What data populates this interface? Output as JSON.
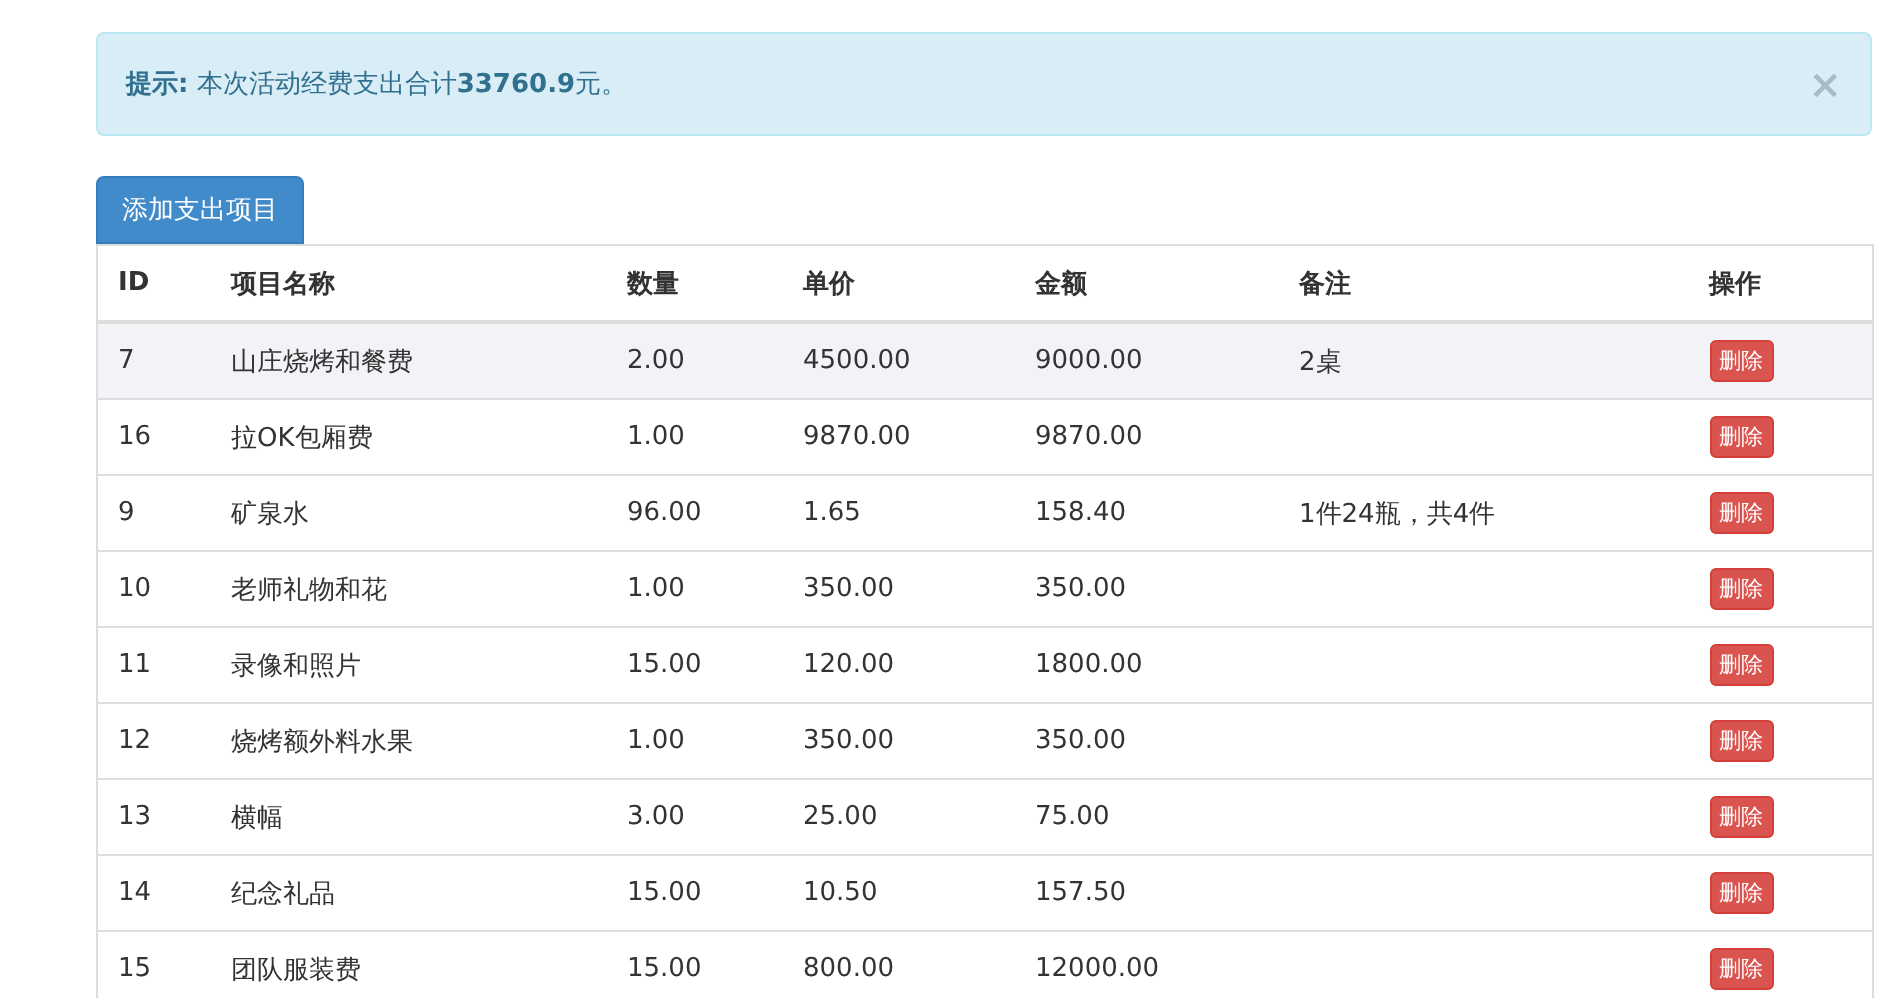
{
  "alert": {
    "message": "**提示:** 本次活动经费支出合计**33760.9**元。",
    "close": "×"
  },
  "add_button": "添加支出项目",
  "table": {
    "columns": [
      "ID",
      "项目名称",
      "数量",
      "单价",
      "金额",
      "备注",
      "操作"
    ],
    "rows": [
      {
        "id": "7",
        "name": "山庄烧烤和餐费",
        "quantity": "2.00",
        "price": "4500.00",
        "amount": "9000.00",
        "note": "2桌",
        "action": "删除",
        "selected": true
      },
      {
        "id": "16",
        "name": "拉OK包厢费",
        "quantity": "1.00",
        "price": "9870.00",
        "amount": "9870.00",
        "action": "删除",
        "selected": false
      },
      {
        "id": "9",
        "name": "矿泉水",
        "quantity": "96.00",
        "price": "1.65",
        "amount": "158.40",
        "note": "1件24瓶，共4件",
        "action": "删除",
        "selected": false
      },
      {
        "id": "10",
        "name": "老师礼物和花",
        "quantity": "1.00",
        "price": "350.00",
        "amount": "350.00",
        "action": "删除",
        "selected": false
      },
      {
        "id": "11",
        "name": "录像和照片",
        "quantity": "15.00",
        "price": "120.00",
        "amount": "1800.00",
        "action": "删除",
        "selected": false
      },
      {
        "id": "12",
        "name": "烧烤额外料水果",
        "quantity": "1.00",
        "price": "350.00",
        "amount": "350.00",
        "action": "删除",
        "selected": false
      },
      {
        "id": "13",
        "name": "横幅",
        "quantity": "3.00",
        "price": "25.00",
        "amount": "75.00",
        "action": "删除",
        "selected": false
      },
      {
        "id": "14",
        "name": "纪念礼品",
        "quantity": "15.00",
        "price": "10.50",
        "amount": "157.50",
        "action": "删除",
        "selected": false
      },
      {
        "id": "15",
        "name": "团队服装费",
        "quantity": "15.00",
        "price": "800.00",
        "amount": "12000.00",
        "action": "删除",
        "selected": false
      }
    ]
  }
}
